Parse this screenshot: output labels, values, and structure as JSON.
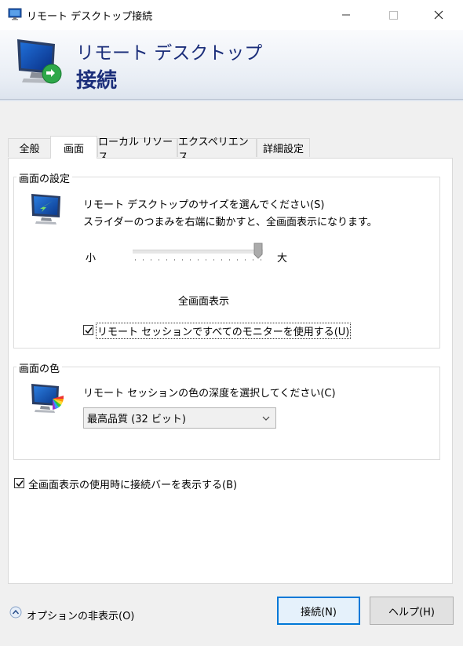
{
  "window": {
    "title": "リモート デスクトップ接続",
    "minimize_icon": "minimize-icon",
    "maximize_icon": "maximize-icon",
    "close_icon": "close-icon"
  },
  "banner": {
    "line1": "リモート デスクトップ",
    "line2": "接続"
  },
  "tabs": [
    {
      "label": "全般"
    },
    {
      "label": "画面",
      "active": true
    },
    {
      "label": "ローカル リソース"
    },
    {
      "label": "エクスペリエンス"
    },
    {
      "label": "詳細設定"
    }
  ],
  "display_settings": {
    "legend": "画面の設定",
    "instruction1": "リモート デスクトップのサイズを選んでください(S)",
    "instruction2": "スライダーのつまみを右端に動かすと、全画面表示になります。",
    "slider_min_label": "小",
    "slider_max_label": "大",
    "slider_value_fraction": 1.0,
    "current_size": "全画面表示",
    "use_all_monitors_label": "リモート セッションですべてのモニターを使用する(U)",
    "use_all_monitors_checked": true
  },
  "colors": {
    "legend": "画面の色",
    "instruction": "リモート セッションの色の深度を選択してください(C)",
    "selected_depth": "最高品質 (32 ビット)"
  },
  "connection_bar": {
    "label": "全画面表示の使用時に接続バーを表示する(B)",
    "checked": true
  },
  "footer": {
    "options_toggle": "オプションの非表示(O)",
    "connect_button": "接続(N)",
    "help_button": "ヘルプ(H)"
  },
  "theme": {
    "banner_text": "#1b2e7a",
    "primary_border": "#0078d7"
  }
}
